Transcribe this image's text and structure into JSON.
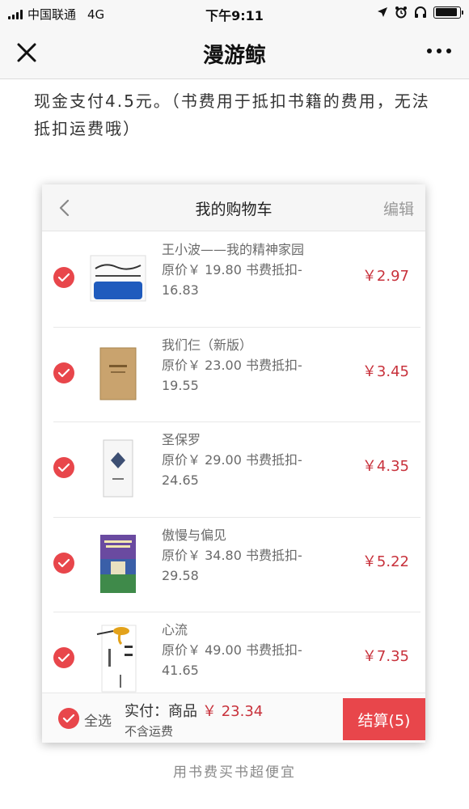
{
  "status_bar": {
    "carrier": "中国联通",
    "network": "4G",
    "time": "下午9:11",
    "battery_level": 0.9
  },
  "nav": {
    "title": "漫游鲸"
  },
  "article": {
    "text": "现金支付4.5元。（书费用于抵扣书籍的费用，无法抵扣运费哦）"
  },
  "cart": {
    "title": "我的购物车",
    "edit_label": "编辑",
    "items": [
      {
        "title": "王小波——我的精神家园",
        "original_price": "原价￥ 19.80",
        "credit_label": "书费抵扣-",
        "credit_value": "16.83",
        "price": "￥2.97",
        "checked": true
      },
      {
        "title": "我们仨（新版）",
        "original_price": "原价￥ 23.00",
        "credit_label": "书费抵扣-",
        "credit_value": "19.55",
        "price": "￥3.45",
        "checked": true
      },
      {
        "title": "圣保罗",
        "original_price": "原价￥ 29.00",
        "credit_label": "书费抵扣-",
        "credit_value": "24.65",
        "price": "￥4.35",
        "checked": true
      },
      {
        "title": "傲慢与偏见",
        "original_price": "原价￥ 34.80",
        "credit_label": "书费抵扣-",
        "credit_value": "29.58",
        "price": "￥5.22",
        "checked": true
      },
      {
        "title": "心流",
        "original_price": "原价￥ 49.00",
        "credit_label": "书费抵扣-",
        "credit_value": "41.65",
        "price": "￥7.35",
        "checked": true
      }
    ],
    "footer": {
      "select_all_label": "全选",
      "total_label": "实付：商品",
      "total_amount": "￥ 23.34",
      "shipping_note": "不含运费",
      "checkout_label": "结算(5)"
    }
  },
  "caption": "用书费买书超便宜",
  "colors": {
    "accent_red": "#e8464b",
    "price_red": "#c8323c"
  },
  "icons": {
    "close": "close-icon",
    "more": "more-icon",
    "back": "chevron-left-icon",
    "check": "check-icon"
  }
}
